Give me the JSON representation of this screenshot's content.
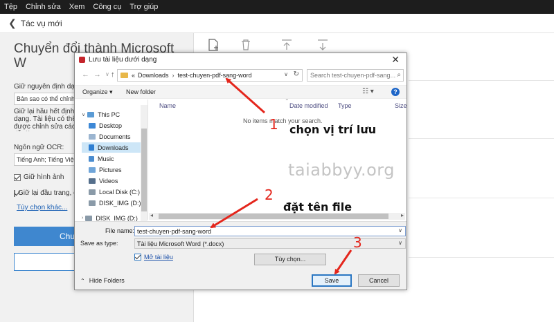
{
  "menubar": {
    "items": [
      "Tệp",
      "Chỉnh sửa",
      "Xem",
      "Công cụ",
      "Trợ giúp"
    ]
  },
  "backbar": {
    "label": "Tác vụ mới"
  },
  "left_panel": {
    "title": "Chuyển đổi thành Microsoft W",
    "keep_format_label": "Giữ nguyên định dạng:",
    "keep_format_value": "Bản sao có thể chỉnh sửa",
    "keep_desc": "Giữ lại hầu hết định dạng. Tài liệu có thể được chỉnh sửa cách dễ dàng.",
    "ocr_label": "Ngôn ngữ OCR:",
    "ocr_value": "Tiếng Anh; Tiếng Việt",
    "keep_images": "Giữ hình ảnh",
    "keep_headers": "Giữ lại đầu trang, chân",
    "more_options": "Tùy chọn khác...",
    "convert_button": "Chuy"
  },
  "dialog": {
    "title": "Lưu tài liệu dưới dạng",
    "breadcrumb": [
      "«",
      "Downloads",
      "test-chuyen-pdf-sang-word"
    ],
    "search_placeholder": "Search test-chuyen-pdf-sang...",
    "organize": "Organize ▾",
    "new_folder": "New folder",
    "nav_items": [
      {
        "label": "This PC",
        "icon": "computer-icon"
      },
      {
        "label": "Desktop",
        "icon": "desktop-icon"
      },
      {
        "label": "Documents",
        "icon": "documents-icon"
      },
      {
        "label": "Downloads",
        "icon": "downloads-icon",
        "selected": true
      },
      {
        "label": "Music",
        "icon": "music-icon"
      },
      {
        "label": "Pictures",
        "icon": "pictures-icon"
      },
      {
        "label": "Videos",
        "icon": "videos-icon"
      },
      {
        "label": "Local Disk (C:)",
        "icon": "disk-icon"
      },
      {
        "label": "DISK_IMG (D:)",
        "icon": "disk-icon"
      },
      {
        "label": "DISK_IMG (D:)",
        "icon": "disk-icon"
      }
    ],
    "columns": [
      "Name",
      "Date modified",
      "Type",
      "Size"
    ],
    "empty_message": "No items match your search.",
    "file_name_label": "File name:",
    "file_name_value": "test-chuyen-pdf-sang-word",
    "save_as_type_label": "Save as type:",
    "save_as_type_value": "Tài liệu Microsoft Word (*.docx)",
    "open_doc_label": "Mở tài liệu",
    "options_button": "Tùy chọn...",
    "hide_folders": "Hide Folders",
    "save_button": "Save",
    "cancel_button": "Cancel"
  },
  "annotations": {
    "step1": "1",
    "step2": "2",
    "step3": "3",
    "note1": "chọn vị trí lưu",
    "note2": "đặt tên file",
    "watermark": "taiabbyy.org",
    "arrow_color": "#e4261c"
  },
  "colors": {
    "accent_blue": "#3f87cf",
    "menubar_bg": "#1d1d1d",
    "selection": "#cde6f7"
  }
}
